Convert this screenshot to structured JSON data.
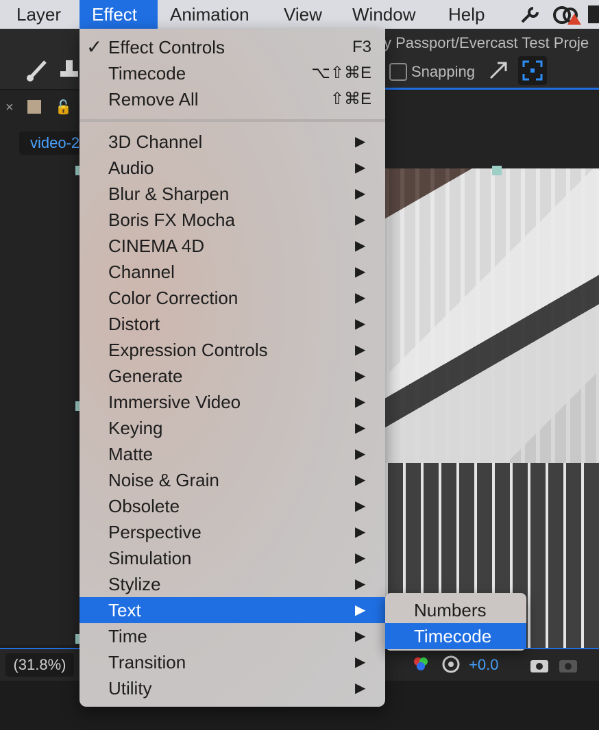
{
  "menubar": {
    "items": [
      "Layer",
      "Effect",
      "Animation",
      "View",
      "Window",
      "Help"
    ]
  },
  "toolbar": {
    "title_fragment": "y Passport/Evercast Test Proje",
    "snapping_label": "Snapping"
  },
  "panel": {
    "comp_tab_label": "video-2"
  },
  "bottom": {
    "zoom": "(31.8%)",
    "exposure": "+0.0"
  },
  "menu": {
    "top_items": [
      {
        "label": "Effect Controls",
        "shortcut": "F3",
        "checked": true
      },
      {
        "label": "Timecode",
        "shortcut": "⌥⇧⌘E"
      },
      {
        "label": "Remove All",
        "shortcut": "⇧⌘E"
      }
    ],
    "categories": [
      "3D Channel",
      "Audio",
      "Blur & Sharpen",
      "Boris FX Mocha",
      "CINEMA 4D",
      "Channel",
      "Color Correction",
      "Distort",
      "Expression Controls",
      "Generate",
      "Immersive Video",
      "Keying",
      "Matte",
      "Noise & Grain",
      "Obsolete",
      "Perspective",
      "Simulation",
      "Stylize",
      "Text",
      "Time",
      "Transition",
      "Utility"
    ],
    "highlighted_category": "Text",
    "check_glyph": "✓",
    "arrow_glyph": "▶"
  },
  "submenu": {
    "items": [
      "Numbers",
      "Timecode"
    ],
    "highlighted": "Timecode"
  },
  "colors": {
    "accent": "#1f6fe3",
    "menubar_bg": "#dadce1"
  }
}
